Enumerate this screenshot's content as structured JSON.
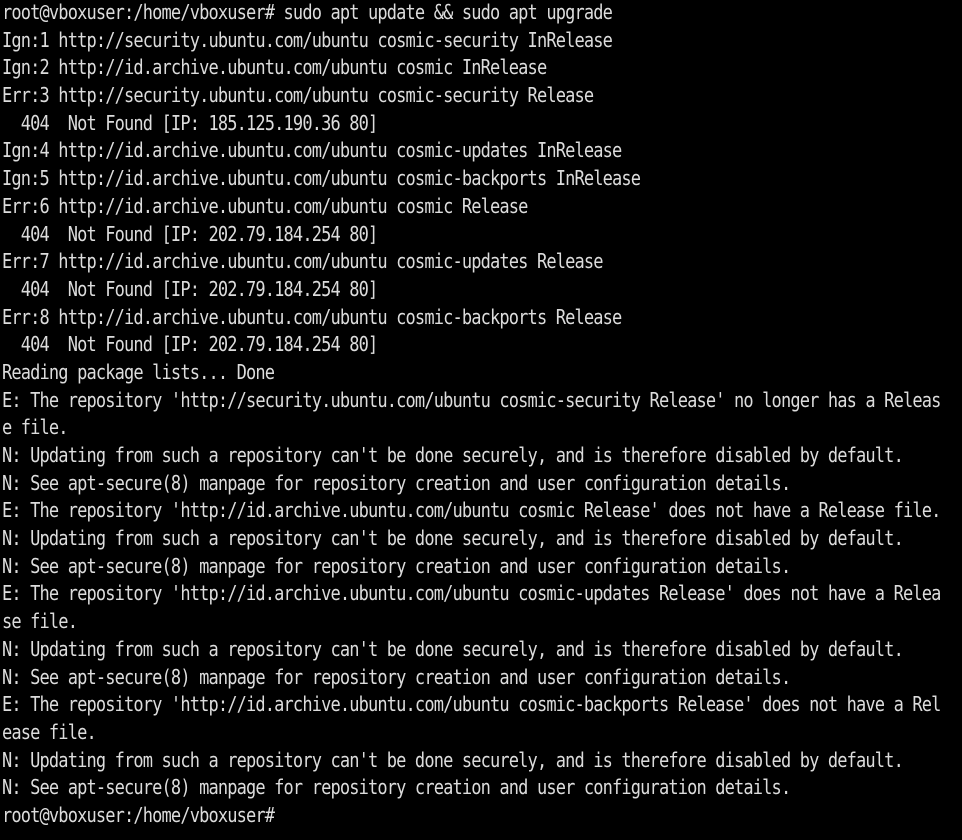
{
  "window": {
    "title": "",
    "background_color": "#000000",
    "text_color": "#dcdcdc"
  },
  "terminal": {
    "lines": [
      "root@vboxuser:/home/vboxuser# sudo apt update && sudo apt upgrade",
      "Ign:1 http://security.ubuntu.com/ubuntu cosmic-security InRelease",
      "Ign:2 http://id.archive.ubuntu.com/ubuntu cosmic InRelease",
      "Err:3 http://security.ubuntu.com/ubuntu cosmic-security Release",
      "  404  Not Found [IP: 185.125.190.36 80]",
      "Ign:4 http://id.archive.ubuntu.com/ubuntu cosmic-updates InRelease",
      "Ign:5 http://id.archive.ubuntu.com/ubuntu cosmic-backports InRelease",
      "Err:6 http://id.archive.ubuntu.com/ubuntu cosmic Release",
      "  404  Not Found [IP: 202.79.184.254 80]",
      "Err:7 http://id.archive.ubuntu.com/ubuntu cosmic-updates Release",
      "  404  Not Found [IP: 202.79.184.254 80]",
      "Err:8 http://id.archive.ubuntu.com/ubuntu cosmic-backports Release",
      "  404  Not Found [IP: 202.79.184.254 80]",
      "Reading package lists... Done",
      "E: The repository 'http://security.ubuntu.com/ubuntu cosmic-security Release' no longer has a Releas",
      "e file.",
      "N: Updating from such a repository can't be done securely, and is therefore disabled by default.",
      "N: See apt-secure(8) manpage for repository creation and user configuration details.",
      "E: The repository 'http://id.archive.ubuntu.com/ubuntu cosmic Release' does not have a Release file.",
      "N: Updating from such a repository can't be done securely, and is therefore disabled by default.",
      "N: See apt-secure(8) manpage for repository creation and user configuration details.",
      "E: The repository 'http://id.archive.ubuntu.com/ubuntu cosmic-updates Release' does not have a Relea",
      "se file.",
      "N: Updating from such a repository can't be done securely, and is therefore disabled by default.",
      "N: See apt-secure(8) manpage for repository creation and user configuration details.",
      "E: The repository 'http://id.archive.ubuntu.com/ubuntu cosmic-backports Release' does not have a Rel",
      "ease file.",
      "N: Updating from such a repository can't be done securely, and is therefore disabled by default.",
      "N: See apt-secure(8) manpage for repository creation and user configuration details.",
      "root@vboxuser:/home/vboxuser#"
    ]
  }
}
